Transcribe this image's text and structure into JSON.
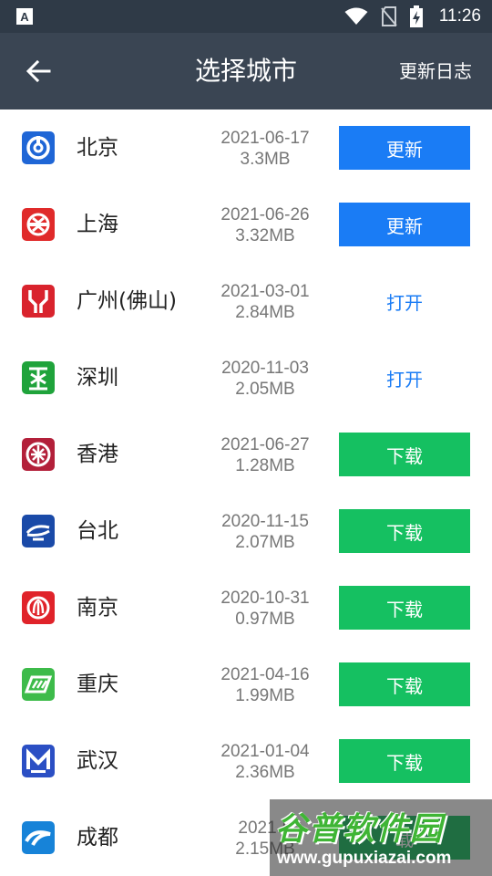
{
  "status": {
    "app_badge": "A",
    "time": "11:26"
  },
  "toolbar": {
    "title": "选择城市",
    "log_label": "更新日志"
  },
  "cities": [
    {
      "name": "北京",
      "date": "2021-06-17",
      "size": "3.3MB",
      "action": "更新",
      "action_type": "update",
      "logo_color": "#1f66d6",
      "icon": "beijing-metro-logo-icon"
    },
    {
      "name": "上海",
      "date": "2021-06-26",
      "size": "3.32MB",
      "action": "更新",
      "action_type": "update",
      "logo_color": "#e02a2a",
      "icon": "shanghai-metro-logo-icon"
    },
    {
      "name": "广州(佛山)",
      "date": "2021-03-01",
      "size": "2.84MB",
      "action": "打开",
      "action_type": "open",
      "logo_color": "#d9232d",
      "icon": "guangzhou-metro-logo-icon"
    },
    {
      "name": "深圳",
      "date": "2020-11-03",
      "size": "2.05MB",
      "action": "打开",
      "action_type": "open",
      "logo_color": "#1fa33b",
      "icon": "shenzhen-metro-logo-icon"
    },
    {
      "name": "香港",
      "date": "2021-06-27",
      "size": "1.28MB",
      "action": "下载",
      "action_type": "download",
      "logo_color": "#b3203a",
      "icon": "hongkong-mtr-logo-icon"
    },
    {
      "name": "台北",
      "date": "2020-11-15",
      "size": "2.07MB",
      "action": "下载",
      "action_type": "download",
      "logo_color": "#1a4aa8",
      "icon": "taipei-metro-logo-icon"
    },
    {
      "name": "南京",
      "date": "2020-10-31",
      "size": "0.97MB",
      "action": "下载",
      "action_type": "download",
      "logo_color": "#e0232a",
      "icon": "nanjing-metro-logo-icon"
    },
    {
      "name": "重庆",
      "date": "2021-04-16",
      "size": "1.99MB",
      "action": "下载",
      "action_type": "download",
      "logo_color": "#3dbb4a",
      "icon": "chongqing-rail-logo-icon"
    },
    {
      "name": "武汉",
      "date": "2021-01-04",
      "size": "2.36MB",
      "action": "下载",
      "action_type": "download",
      "logo_color": "#2b4fc4",
      "icon": "wuhan-metro-logo-icon"
    },
    {
      "name": "成都",
      "date": "2021-0",
      "size": "2.15MB",
      "action": "载",
      "action_type": "download",
      "logo_color": "#1783d8",
      "icon": "chengdu-metro-logo-icon"
    }
  ],
  "watermark": {
    "title": "谷普软件园",
    "url": "www.gupuxiazai.com"
  }
}
